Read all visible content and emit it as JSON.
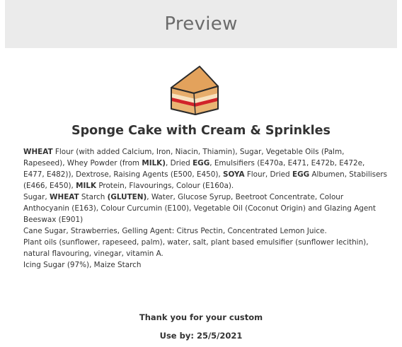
{
  "header": {
    "title": "Preview"
  },
  "product": {
    "icon": "cake-slice-icon",
    "name": "Sponge Cake with Cream & Sprinkles"
  },
  "ingredients": [
    [
      {
        "text": "WHEAT",
        "bold": true
      },
      {
        "text": " Flour (with added Calcium, Iron, Niacin, Thiamin), Sugar, Vegetable Oils (Palm, Rapeseed), Whey Powder (from ",
        "bold": false
      },
      {
        "text": "MILK)",
        "bold": true
      },
      {
        "text": ", Dried ",
        "bold": false
      },
      {
        "text": "EGG",
        "bold": true
      },
      {
        "text": ", Emulsifiers (E470a, E471, E472b, E472e, E477, E482)), Dextrose, Raising Agents (E500, E450), ",
        "bold": false
      },
      {
        "text": "SOYA",
        "bold": true
      },
      {
        "text": " Flour, Dried ",
        "bold": false
      },
      {
        "text": "EGG",
        "bold": true
      },
      {
        "text": " Albumen, Stabilisers (E466, E450), ",
        "bold": false
      },
      {
        "text": "MILK",
        "bold": true
      },
      {
        "text": " Protein, Flavourings, Colour (E160a).",
        "bold": false
      }
    ],
    [
      {
        "text": "Sugar, ",
        "bold": false
      },
      {
        "text": "WHEAT",
        "bold": true
      },
      {
        "text": " Starch ",
        "bold": false
      },
      {
        "text": "(GLUTEN)",
        "bold": true
      },
      {
        "text": ", Water, Glucose Syrup, Beetroot Concentrate, Colour Anthocyanin (E163), Colour Curcumin (E100), Vegetable Oil (Coconut Origin) and Glazing Agent Beeswax (E901)",
        "bold": false
      }
    ],
    [
      {
        "text": "Cane Sugar, Strawberries, Gelling Agent: Citrus Pectin, Concentrated Lemon Juice.",
        "bold": false
      }
    ],
    [
      {
        "text": "Plant oils (sunflower, rapeseed, palm), water, salt, plant based emulsifier (sunflower lecithin), natural flavouring, vinegar, vitamin A.",
        "bold": false
      }
    ],
    [
      {
        "text": "Icing Sugar (97%), Maize Starch",
        "bold": false
      }
    ]
  ],
  "footer": {
    "thanks": "Thank you for your custom",
    "use_by": "Use by: 25/5/2021"
  },
  "colors": {
    "header_bg": "#ebebeb",
    "cake_sponge": "#e3a25c",
    "cake_cream": "#f6d9b3",
    "cake_jam": "#d1232a",
    "text": "#333333"
  }
}
